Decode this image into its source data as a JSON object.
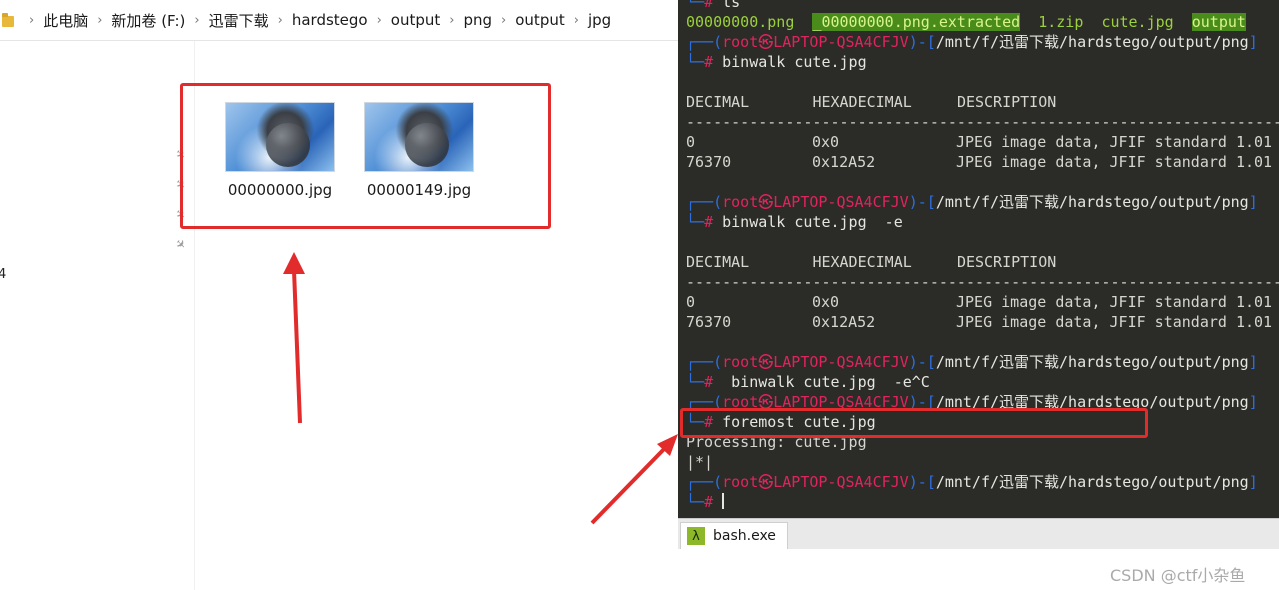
{
  "explorer": {
    "breadcrumb": [
      "此电脑",
      "新加卷 (F:)",
      "迅雷下载",
      "hardstego",
      "output",
      "png",
      "output",
      "jpg"
    ],
    "nav_stub": "4",
    "files": [
      {
        "name": "00000000.jpg"
      },
      {
        "name": "00000149.jpg"
      }
    ]
  },
  "terminal": {
    "prompt_user": "root㉿LAPTOP-QSA4CFJV",
    "prompt_path": "/mnt/f/迅雷下载/hardstego/output/png",
    "top_partial": "ls",
    "ls_output": [
      "00000000.png",
      "_00000000.png.extracted",
      "1.zip",
      "cute.jpg",
      "output"
    ],
    "cmd1": "binwalk cute.jpg",
    "table_header": {
      "decimal": "DECIMAL",
      "hex": "HEXADECIMAL",
      "desc": "DESCRIPTION"
    },
    "separator": "--------------------------------------------------------------------------------",
    "table1_rows": [
      {
        "decimal": "0",
        "hex": "0x0",
        "desc": "JPEG image data, JFIF standard 1.01"
      },
      {
        "decimal": "76370",
        "hex": "0x12A52",
        "desc": "JPEG image data, JFIF standard 1.01"
      }
    ],
    "cmd2": "binwalk cute.jpg  -e",
    "table2_rows": [
      {
        "decimal": "0",
        "hex": "0x0",
        "desc": "JPEG image data, JFIF standard 1.01"
      },
      {
        "decimal": "76370",
        "hex": "0x12A52",
        "desc": "JPEG image data, JFIF standard 1.01"
      }
    ],
    "cmd3": " binwalk cute.jpg  -e^C",
    "cmd4": "foremost cute.jpg",
    "processing": "Processing: cute.jpg",
    "progress": "|*|"
  },
  "tabbar": {
    "tab_label": "bash.exe",
    "tab_icon": "λ"
  },
  "watermark": "CSDN @ctf小杂鱼",
  "colors": {
    "annotation_red": "#e22b2b",
    "terminal_bg": "#2b2c28",
    "prompt_red": "#e0245e",
    "prompt_blue": "#2e6fe0"
  }
}
